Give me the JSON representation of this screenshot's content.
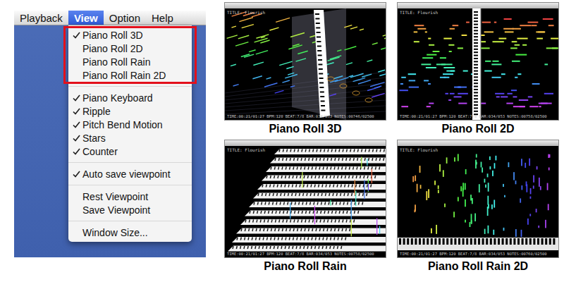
{
  "menubar": [
    {
      "label": "Playback",
      "selected": false
    },
    {
      "label": "View",
      "selected": true
    },
    {
      "label": "Option",
      "selected": false
    },
    {
      "label": "Help",
      "selected": false
    }
  ],
  "menu": {
    "groups": [
      {
        "highlighted": true,
        "items": [
          {
            "label": "Piano Roll 3D",
            "checked": true
          },
          {
            "label": "Piano Roll 2D",
            "checked": false
          },
          {
            "label": "Piano Roll Rain",
            "checked": false
          },
          {
            "label": "Piano Roll Rain 2D",
            "checked": false
          }
        ]
      },
      {
        "highlighted": false,
        "items": [
          {
            "label": "Piano Keyboard",
            "checked": true
          },
          {
            "label": "Ripple",
            "checked": true
          },
          {
            "label": "Pitch Bend Motion",
            "checked": true
          },
          {
            "label": "Stars",
            "checked": true
          },
          {
            "label": "Counter",
            "checked": true
          }
        ]
      },
      {
        "highlighted": false,
        "items": [
          {
            "label": "Auto save viewpoint",
            "checked": true
          }
        ]
      },
      {
        "highlighted": false,
        "items": [
          {
            "label": "Rest Viewpoint",
            "checked": false
          },
          {
            "label": "Save Viewpoint",
            "checked": false
          }
        ]
      },
      {
        "highlighted": false,
        "items": [
          {
            "label": "Window Size...",
            "checked": false
          }
        ]
      }
    ]
  },
  "views": [
    {
      "caption": "Piano Roll 3D",
      "kind": "roll-3d",
      "title": "TITLE: Flourish",
      "counter": "TIME:00:21/01:27 BPM:120 BEAT:7/8 BAR:034/053 NOTES:00746/02500"
    },
    {
      "caption": "Piano Roll 2D",
      "kind": "roll-2d",
      "title": "TITLE: Flourish",
      "counter": "TIME:00:21/01:27 BPM:120 BEAT:7/8 BAR:034/053 NOTES:00758/02500"
    },
    {
      "caption": "Piano Roll Rain",
      "kind": "rain",
      "title": "TITLE: Flourish",
      "counter": "TIME:00:21/01:27 BPM:120 BEAT:7/8 BAR:034/053 NOTES:00758/02500"
    },
    {
      "caption": "Piano Roll Rain 2D",
      "kind": "rain-2d",
      "title": "TITLE: Flourish",
      "counter": "TIME:00:21/01:27 BPM:120 BEAT:7/8 BAR:034/053 NOTES:00760/02500"
    }
  ]
}
